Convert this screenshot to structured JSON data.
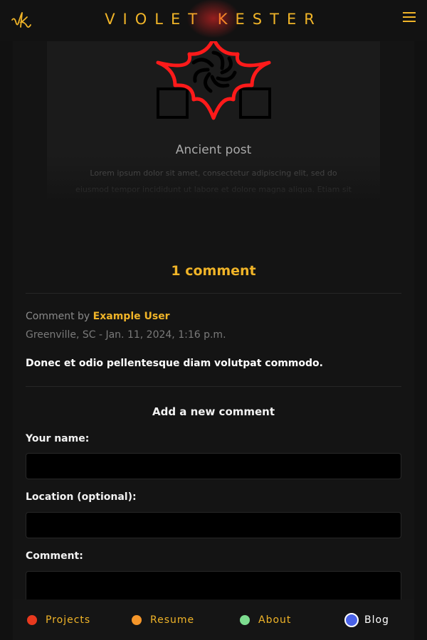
{
  "header": {
    "site_title": "VIOLET KESTER",
    "logo_icon": "vk-monogram-icon",
    "menu_icon": "hamburger-menu-icon",
    "accent_color": "#f0b428"
  },
  "post": {
    "title": "Ancient post",
    "excerpt": "Lorem ipsum dolor sit amet, consectetur adipiscing elit, sed do eiusmod tempor incididunt ut labore et dolore magna aliqua. Etiam sit amet nisl purus in mollis nunc sed. Orci eu",
    "art_icon": "spiral-star-icon"
  },
  "comments": {
    "heading": "1 comment",
    "items": [
      {
        "prefix": "Comment by",
        "author": "Example User",
        "location_date": "Greenville, SC - Jan. 11, 2024, 1:16 p.m.",
        "body": "Donec et odio pellentesque diam volutpat commodo."
      }
    ]
  },
  "form": {
    "heading": "Add a new comment",
    "name_label": "Your name:",
    "location_label": "Location (optional):",
    "comment_label": "Comment:",
    "name_value": "",
    "location_value": "",
    "comment_value": ""
  },
  "nav": {
    "items": [
      {
        "label": "Projects",
        "color": "#e8391e"
      },
      {
        "label": "Resume",
        "color": "#f5962a"
      },
      {
        "label": "About",
        "color": "#7ddc8f"
      },
      {
        "label": "Blog",
        "color": "#4a62e8",
        "active": true
      }
    ]
  }
}
